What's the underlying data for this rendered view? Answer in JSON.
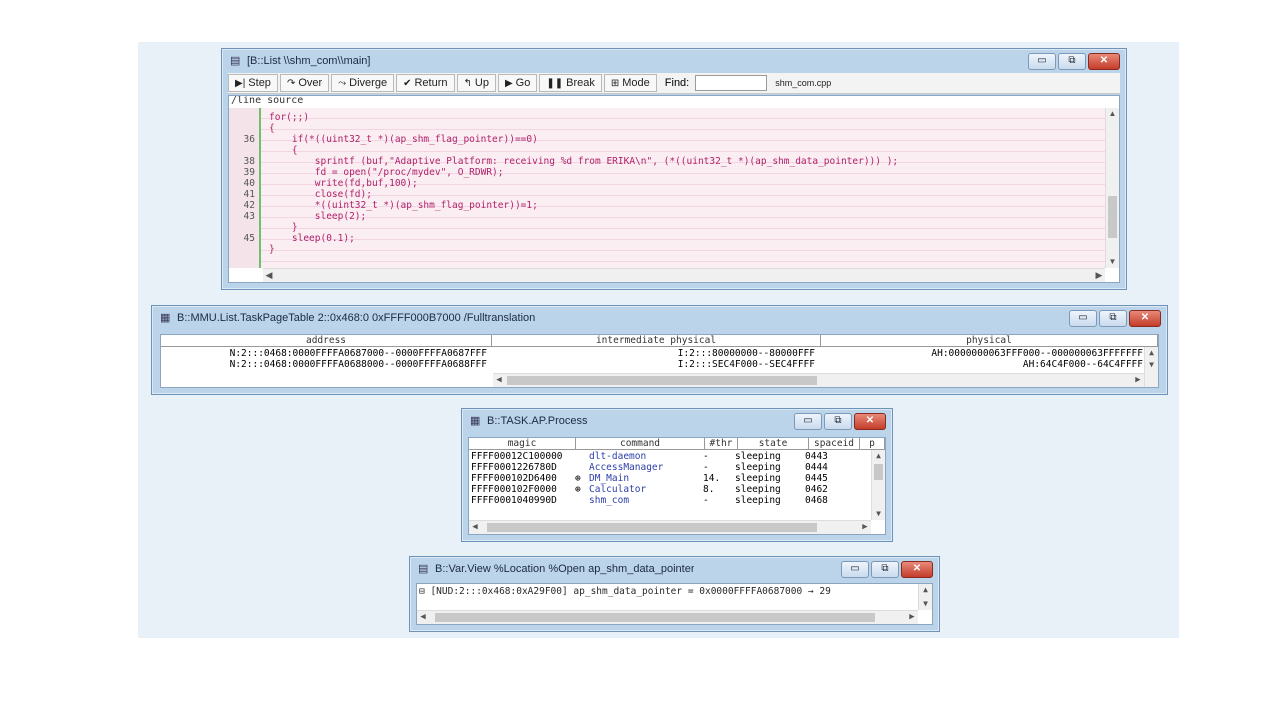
{
  "colors": {
    "desktop": "#e9f1f8",
    "window_frame": "#bcd4ea",
    "source_bg": "#fbeef3",
    "code_text": "#b0226a",
    "close_button": "#c43c2a",
    "link_blue": "#2c3fa8"
  },
  "window_buttons": {
    "minimize": "▭",
    "maximize": "⧉",
    "close": "✕"
  },
  "list_window": {
    "title": "[B::List \\\\shm_com\\\\main]",
    "toolbar": [
      {
        "label": "Step",
        "icon": "step-icon",
        "glyph": "▶|"
      },
      {
        "label": "Over",
        "icon": "over-icon",
        "glyph": "↷"
      },
      {
        "label": "Diverge",
        "icon": "diverge-icon",
        "glyph": "⤳"
      },
      {
        "label": "Return",
        "icon": "return-icon",
        "glyph": "✔"
      },
      {
        "label": "Up",
        "icon": "up-icon",
        "glyph": "↰"
      },
      {
        "label": "Go",
        "icon": "go-icon",
        "glyph": "▶"
      },
      {
        "label": "Break",
        "icon": "break-icon",
        "glyph": "❚❚"
      },
      {
        "label": "Mode",
        "icon": "mode-icon",
        "glyph": "⊞"
      }
    ],
    "find_label": "Find:",
    "find_value": "",
    "file_name": "shm_com.cpp",
    "header": "/line source",
    "lines": [
      {
        "num": "",
        "code": "for(;;)"
      },
      {
        "num": "",
        "code": "{"
      },
      {
        "num": "36",
        "code": "    if(*((uint32_t *)(ap_shm_flag_pointer))==0)"
      },
      {
        "num": "",
        "code": "    {"
      },
      {
        "num": "38",
        "code": "        sprintf (buf,\"Adaptive Platform: receiving %d from ERIKA\\n\", (*((uint32_t *)(ap_shm_data_pointer))) );"
      },
      {
        "num": "39",
        "code": "        fd = open(\"/proc/mydev\", O_RDWR);"
      },
      {
        "num": "40",
        "code": "        write(fd,buf,100);"
      },
      {
        "num": "41",
        "code": "        close(fd);"
      },
      {
        "num": "42",
        "code": "        *((uint32_t *)(ap_shm_flag_pointer))=1;"
      },
      {
        "num": "43",
        "code": "        sleep(2);"
      },
      {
        "num": "",
        "code": "    }"
      },
      {
        "num": "45",
        "code": "    sleep(0.1);"
      },
      {
        "num": "",
        "code": "}"
      }
    ]
  },
  "mmu_window": {
    "title": "B::MMU.List.TaskPageTable 2::0x468:0 0xFFFF000B7000 /Fulltranslation",
    "columns": [
      "address",
      "intermediate physical",
      "physical"
    ],
    "rows": [
      {
        "address": "N:2:::0468:0000FFFFA0687000--0000FFFFA0687FFF",
        "intermediate": "I:2:::80000000--80000FFF",
        "physical": "AH:0000000063FFF000--000000063FFFFFFF"
      },
      {
        "address": "N:2:::0468:0000FFFFA0688000--0000FFFFA0688FFF",
        "intermediate": "I:2:::SEC4F000--SEC4FFFF",
        "physical": "AH:64C4F000--64C4FFFF"
      }
    ]
  },
  "task_window": {
    "title": "B::TASK.AP.Process",
    "columns": [
      "magic",
      "command",
      "#thr",
      "state",
      "spaceid",
      "p"
    ],
    "rows": [
      {
        "magic": "FFFF00012C100000",
        "expand": "",
        "command": "dlt-daemon",
        "thr": "-",
        "state": "sleeping",
        "spaceid": "0443"
      },
      {
        "magic": "FFFF0001226780D",
        "expand": "",
        "command": "AccessManager",
        "thr": "-",
        "state": "sleeping",
        "spaceid": "0444"
      },
      {
        "magic": "FFFF000102D6400",
        "expand": "⊕",
        "command": "DM_Main",
        "thr": "14.",
        "state": "sleeping",
        "spaceid": "0445"
      },
      {
        "magic": "FFFF000102F0000",
        "expand": "⊕",
        "command": "Calculator",
        "thr": "8.",
        "state": "sleeping",
        "spaceid": "0462"
      },
      {
        "magic": "FFFF0001040990D",
        "expand": "",
        "command": "shm_com",
        "thr": "-",
        "state": "sleeping",
        "spaceid": "0468"
      }
    ]
  },
  "var_window": {
    "title": "B::Var.View %Location %Open ap_shm_data_pointer",
    "line": "⊟ [NUD:2:::0x468:0xA29F00] ap_shm_data_pointer = 0x0000FFFFA0687000 → 29"
  }
}
